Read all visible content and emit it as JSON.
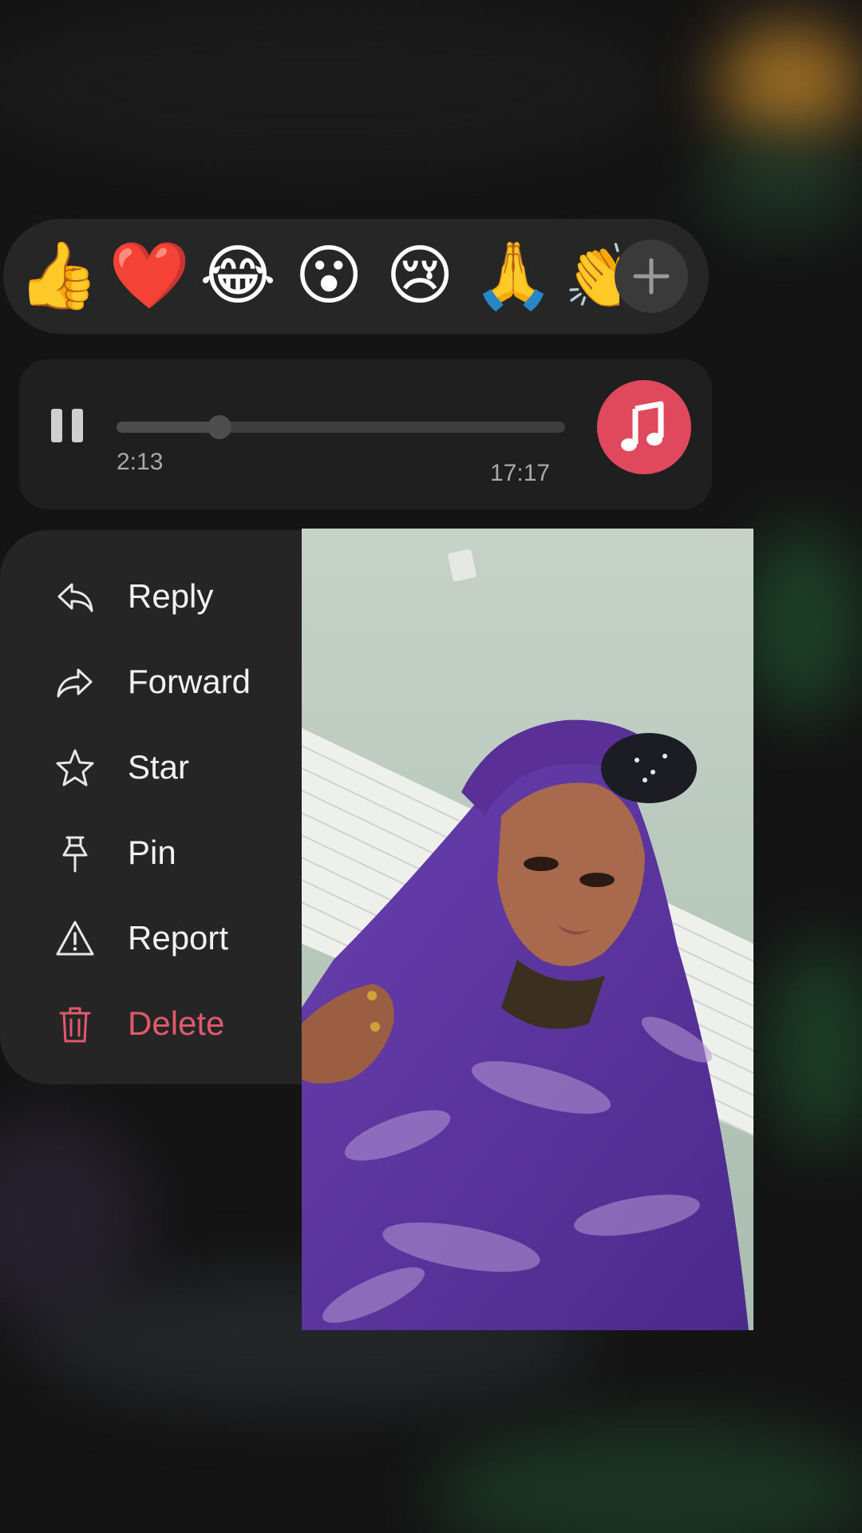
{
  "reactions": {
    "emojis": [
      {
        "name": "thumbs-up",
        "glyph": "👍"
      },
      {
        "name": "red-heart",
        "glyph": "❤️",
        "selected": true
      },
      {
        "name": "tears-of-joy",
        "glyph": "😂"
      },
      {
        "name": "surprised",
        "glyph": "😮"
      },
      {
        "name": "crying",
        "glyph": "😢"
      },
      {
        "name": "praying-hands",
        "glyph": "🙏"
      },
      {
        "name": "clapping-hands",
        "glyph": "👏"
      }
    ],
    "more_icon": "plus-icon"
  },
  "audio": {
    "current_time": "2:13",
    "duration": "17:17",
    "progress": 0.23,
    "state": "playing",
    "badge_icon": "music-note-icon",
    "badge_color": "#e0485e"
  },
  "menu": {
    "items": [
      {
        "label": "Reply",
        "icon": "reply-icon"
      },
      {
        "label": "Forward",
        "icon": "forward-icon"
      },
      {
        "label": "Star",
        "icon": "star-icon"
      },
      {
        "label": "Pin",
        "icon": "pin-icon"
      },
      {
        "label": "Report",
        "icon": "warning-icon"
      },
      {
        "label": "Delete",
        "icon": "trash-icon",
        "color": "#e05a6b"
      }
    ]
  },
  "media": {
    "kind": "photo"
  }
}
